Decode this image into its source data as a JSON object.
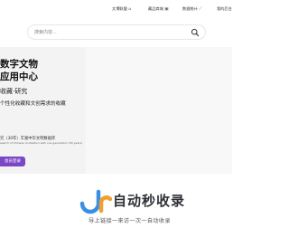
{
  "nav": {
    "items": [
      {
        "label": "文博联盟",
        "icon": "home-icon"
      },
      {
        "label": "藏品商城",
        "icon": "shop-icon"
      },
      {
        "label": "数据统计",
        "icon": "chart-icon"
      },
      {
        "label": "我的后台",
        "icon": ""
      }
    ]
  },
  "search": {
    "placeholder": "搜索内容..."
  },
  "hero": {
    "title_line1": "数字文物",
    "title_line2": "应用中心",
    "subtitle": "收藏·研究",
    "description": "个性化收藏和文创需求的收藏",
    "note_line1": "究（30年）丰富中华文明数据库",
    "note_line2": "search of Chinese civilization with one generation (30 years)",
    "cta_label": "会员登录",
    "cta_color": "#7b47c5"
  },
  "watermark": {
    "brand": "自动秒收录",
    "slogan": "导上链接一来访一次一自动收录",
    "logo_colors": [
      "#3a8ee6",
      "#f0a030"
    ]
  }
}
